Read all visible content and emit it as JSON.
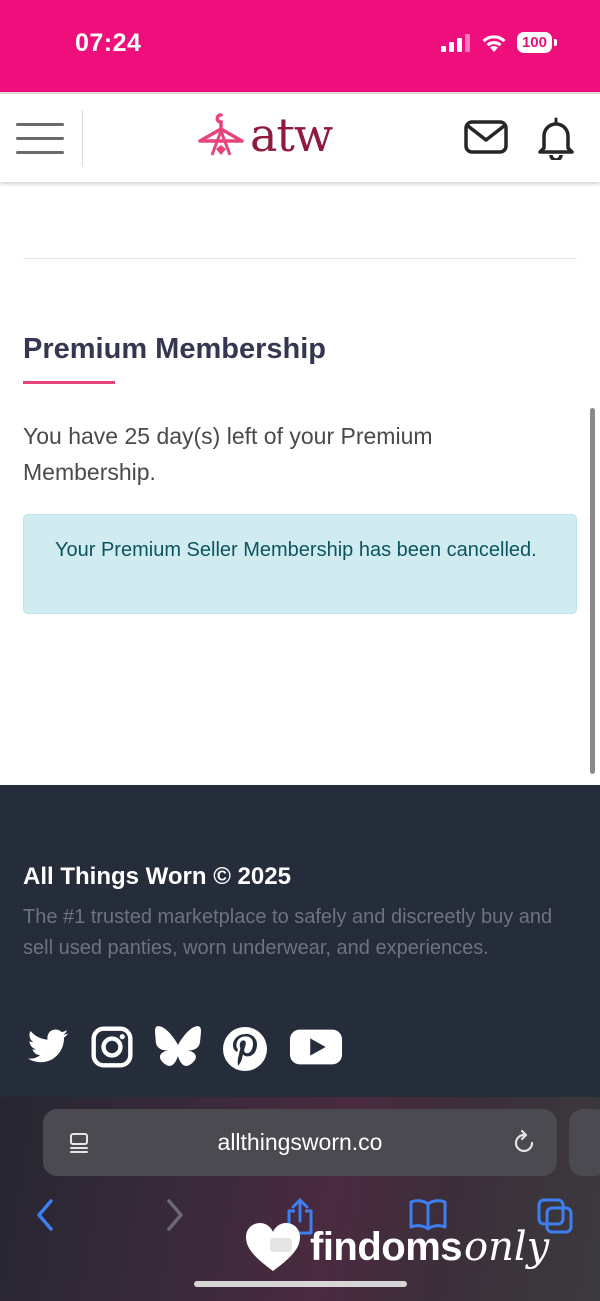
{
  "status_bar": {
    "time": "07:24",
    "battery": "100"
  },
  "header": {
    "logo_text": "atw"
  },
  "main": {
    "section_title": "Premium Membership",
    "days_message": "You have 25 day(s) left of your Premium Membership.",
    "alert_message": "Your Premium Seller Membership has been cancelled."
  },
  "footer": {
    "title": "All Things Worn © 2025",
    "description": "The #1 trusted marketplace to safely and discreetly buy and sell used panties, worn underwear, and experiences.",
    "social_icons": [
      "twitter-icon",
      "instagram-icon",
      "bluesky-icon",
      "pinterest-icon",
      "youtube-icon"
    ]
  },
  "browser": {
    "url": "allthingsworn.co"
  },
  "watermark": {
    "brand": "findoms",
    "script": "only"
  },
  "colors": {
    "brand_pink": "#ee0f7d",
    "logo_maroon": "#8e1a3d",
    "footer_bg": "#252c3a",
    "alert_bg": "#d1ecf1",
    "alert_text": "#0c5460",
    "safari_blue": "#3d7ff0"
  }
}
